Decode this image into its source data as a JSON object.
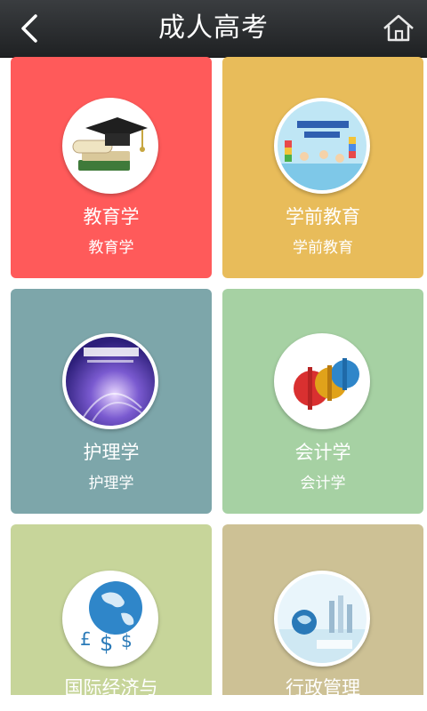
{
  "header": {
    "title": "成人高考",
    "back_icon": "chevron-left-icon",
    "home_icon": "home-icon"
  },
  "colors": {
    "header_bg": "#2a2c2e",
    "education": "#ff5a5a",
    "preschool": "#e8bc5a",
    "nursing": "#7da6aa",
    "accounting": "#a6d1a3",
    "economics": "#c7d59a",
    "admin": "#cdc195"
  },
  "courses": [
    {
      "title": "教育学",
      "subtitle": "教育学",
      "icon": "graduation-cap-books-image"
    },
    {
      "title": "学前教育",
      "subtitle": "学前教育",
      "icon": "children-blocks-image"
    },
    {
      "title": "护理学",
      "subtitle": "护理学",
      "icon": "nursing-book-cover-image"
    },
    {
      "title": "会计学",
      "subtitle": "会计学",
      "icon": "currency-symbols-image"
    },
    {
      "title": "国际经济与",
      "subtitle": "",
      "icon": "globe-currency-image"
    },
    {
      "title": "行政管理",
      "subtitle": "",
      "icon": "globe-city-image"
    }
  ]
}
